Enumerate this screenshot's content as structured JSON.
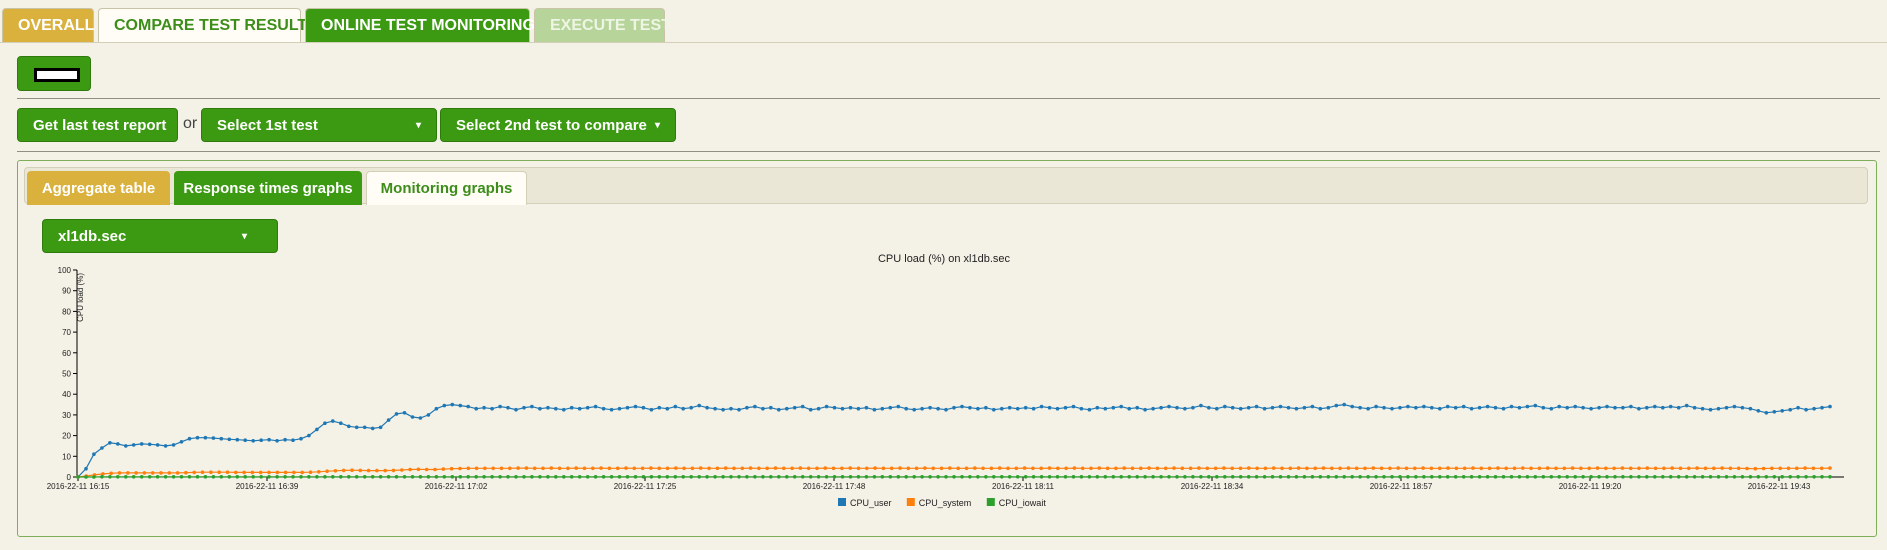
{
  "top_tabs": [
    {
      "label": "OVERALL"
    },
    {
      "label": "COMPARE TEST RESULTS"
    },
    {
      "label": "ONLINE TEST MONITORING"
    },
    {
      "label": "EXECUTE TEST"
    }
  ],
  "actions": {
    "last_report_label": "Get last test report",
    "or_label": "or",
    "select_first_label": "Select 1st test",
    "select_second_label": "Select 2nd test to compare"
  },
  "sub_tabs": [
    {
      "label": "Aggregate table"
    },
    {
      "label": "Response times graphs"
    },
    {
      "label": "Monitoring graphs"
    }
  ],
  "host_select": {
    "value": "xl1db.sec"
  },
  "chart_data": {
    "type": "line",
    "title": "CPU load (%) on xl1db.sec",
    "ylabel": "CPU load (%)",
    "xlabel": "",
    "ylim": [
      0,
      100
    ],
    "yticks": [
      0,
      10,
      20,
      30,
      40,
      50,
      60,
      70,
      80,
      90,
      100
    ],
    "xticks": [
      "2016-22-11 16:15",
      "2016-22-11 16:39",
      "2016-22-11 17:02",
      "2016-22-11 17:25",
      "2016-22-11 17:48",
      "2016-22-11 18:11",
      "2016-22-11 18:34",
      "2016-22-11 18:57",
      "2016-22-11 19:20",
      "2016-22-11 19:43"
    ],
    "legend_position": "bottom-center",
    "series": [
      {
        "name": "CPU_user",
        "color": "#1f77b4",
        "values": [
          0,
          4,
          11,
          14,
          16.5,
          16,
          15,
          15.5,
          16,
          15.8,
          15.5,
          15,
          15.5,
          17,
          18.5,
          19,
          19,
          18.8,
          18.5,
          18.2,
          18,
          17.8,
          17.5,
          17.8,
          18,
          17.5,
          18,
          17.8,
          18.5,
          20,
          23,
          26,
          27,
          26,
          24.5,
          24,
          24,
          23.5,
          24,
          27.5,
          30.5,
          31,
          29,
          28.5,
          30,
          33,
          34.5,
          35,
          34.5,
          34,
          33,
          33.5,
          33,
          34,
          33.5,
          32.5,
          33.5,
          34,
          33,
          33.5,
          33,
          32.5,
          33.5,
          33,
          33.5,
          34,
          33,
          32.5,
          33,
          33.5,
          34,
          33.5,
          32.5,
          33.5,
          33,
          34,
          33,
          33.5,
          34.5,
          33.5,
          33,
          32.5,
          33,
          32.5,
          33.5,
          34,
          33,
          33.5,
          32.5,
          33,
          33.5,
          34,
          32.5,
          33,
          34,
          33.5,
          33,
          33.5,
          33,
          33.5,
          32.5,
          33,
          33.5,
          34,
          33,
          32.5,
          33,
          33.5,
          33,
          32.5,
          33.5,
          34,
          33.5,
          33,
          33.5,
          32.5,
          33,
          33.5,
          33,
          33.5,
          33,
          34,
          33.5,
          33,
          33.5,
          34,
          33,
          32.5,
          33.5,
          33,
          33.5,
          34,
          33,
          33.5,
          32.5,
          33,
          33.5,
          34,
          33.5,
          33,
          33.5,
          34.5,
          33.5,
          33,
          34,
          33.5,
          33,
          33.5,
          34,
          33,
          33.5,
          34,
          33.5,
          33,
          33.5,
          34,
          33,
          33.5,
          34.5,
          35,
          34,
          33.5,
          33,
          34,
          33.5,
          33,
          33.5,
          34,
          33.5,
          34,
          33.5,
          33,
          34,
          33.5,
          34,
          33,
          33.5,
          34,
          33.5,
          33,
          34,
          33.5,
          34,
          34.5,
          33.5,
          33,
          34,
          33.5,
          34,
          33.5,
          33,
          33.5,
          34,
          33.5,
          33.5,
          34,
          33,
          33.5,
          34,
          33.5,
          34,
          33.5,
          34.5,
          33.5,
          33,
          32.5,
          33,
          33.5,
          34,
          33.5,
          33,
          32,
          31,
          31.5,
          32,
          32.5,
          33.5,
          32.5,
          33,
          33.5,
          34
        ]
      },
      {
        "name": "CPU_system",
        "color": "#ff7f0e",
        "values": [
          0,
          0.5,
          1,
          1.5,
          1.8,
          2,
          2,
          2,
          2,
          2,
          2,
          2,
          2,
          2.1,
          2.2,
          2.3,
          2.3,
          2.3,
          2.3,
          2.2,
          2.2,
          2.2,
          2.2,
          2.2,
          2.2,
          2.2,
          2.2,
          2.2,
          2.3,
          2.5,
          2.8,
          3,
          3.2,
          3.3,
          3.2,
          3.1,
          3.1,
          3.1,
          3.2,
          3.4,
          3.6,
          3.7,
          3.6,
          3.6,
          3.8,
          4,
          4.1,
          4.2,
          4.2,
          4.2,
          4.2,
          4.2,
          4.2,
          4.3,
          4.3,
          4.2,
          4.2,
          4.3,
          4.2,
          4.2,
          4.3,
          4.2,
          4.2,
          4.3,
          4.2,
          4.2,
          4.3,
          4.2,
          4.2,
          4.3,
          4.2,
          4.2,
          4.3,
          4.2,
          4.2,
          4.3,
          4.2,
          4.2,
          4.3,
          4.2,
          4.2,
          4.3,
          4.2,
          4.2,
          4.3,
          4.2,
          4.2,
          4.3,
          4.2,
          4.2,
          4.3,
          4.2,
          4.2,
          4.3,
          4.2,
          4.2,
          4.3,
          4.2,
          4.2,
          4.3,
          4.2,
          4.2,
          4.3,
          4.2,
          4.2,
          4.3,
          4.2,
          4.2,
          4.3,
          4.2,
          4.2,
          4.3,
          4.2,
          4.2,
          4.3,
          4.2,
          4.2,
          4.3,
          4.2,
          4.2,
          4.3,
          4.2,
          4.2,
          4.3,
          4.2,
          4.2,
          4.3,
          4.2,
          4.2,
          4.3,
          4.2,
          4.2,
          4.3,
          4.2,
          4.2,
          4.3,
          4.2,
          4.2,
          4.3,
          4.2,
          4.2,
          4.3,
          4.2,
          4.2,
          4.3,
          4.2,
          4.2,
          4.3,
          4.2,
          4.2,
          4.3,
          4.2,
          4.2,
          4.3,
          4.2,
          4.2,
          4.3,
          4.2,
          4.2,
          4.3,
          4.2,
          4.2,
          4.3,
          4.2,
          4.2,
          4.3,
          4.2,
          4.2,
          4.3,
          4.2,
          4.2,
          4.3,
          4.2,
          4.2,
          4.3,
          4.2,
          4.2,
          4.3,
          4.2,
          4.2,
          4.3,
          4.2,
          4.2,
          4.3,
          4.2,
          4.2,
          4.3,
          4.2,
          4.2,
          4.3,
          4.2,
          4.2,
          4.3,
          4.2,
          4.2,
          4.3,
          4.2,
          4.2,
          4.3,
          4.2,
          4.2,
          4.1,
          4,
          4.1,
          4.2,
          4.2,
          4.2,
          4.2,
          4.3,
          4.2,
          4.2,
          4.3
        ]
      },
      {
        "name": "CPU_iowait",
        "color": "#2ca02c",
        "values": [
          0,
          0,
          0,
          0.1,
          0.1,
          0.1,
          0.1,
          0.1,
          0.1,
          0.1,
          0.1,
          0.1,
          0.1,
          0.1,
          0.1,
          0.1,
          0.1,
          0.1,
          0.1,
          0.1,
          0.1,
          0.1,
          0.1,
          0.1,
          0.1,
          0.1,
          0.1,
          0.1,
          0.1,
          0.1,
          0.1,
          0.1,
          0.1,
          0.1,
          0.1,
          0.1,
          0.1,
          0.1,
          0.1,
          0.1,
          0.1,
          0.1,
          0.1,
          0.1,
          0.1,
          0.1,
          0.1,
          0.1,
          0.1,
          0.1,
          0.1,
          0.1,
          0.1,
          0.1,
          0.1,
          0.1,
          0.1,
          0.1,
          0.1,
          0.1,
          0.1,
          0.1,
          0.1,
          0.1,
          0.1,
          0.1,
          0.1,
          0.1,
          0.1,
          0.1,
          0.1,
          0.1,
          0.1,
          0.1,
          0.1,
          0.1,
          0.1,
          0.1,
          0.1,
          0.1,
          0.1,
          0.1,
          0.1,
          0.1,
          0.1,
          0.1,
          0.1,
          0.1,
          0.1,
          0.1,
          0.1,
          0.1,
          0.1,
          0.1,
          0.1,
          0.1,
          0.1,
          0.1,
          0.1,
          0.1,
          0.1,
          0.1,
          0.1,
          0.1,
          0.1,
          0.1,
          0.1,
          0.1,
          0.1,
          0.1,
          0.1,
          0.1,
          0.1,
          0.1,
          0.1,
          0.1,
          0.1,
          0.1,
          0.1,
          0.1,
          0.1,
          0.1,
          0.1,
          0.1,
          0.1,
          0.1,
          0.1,
          0.1,
          0.1,
          0.1,
          0.1,
          0.1,
          0.1,
          0.1,
          0.1,
          0.1,
          0.1,
          0.1,
          0.1,
          0.1,
          0.1,
          0.1,
          0.1,
          0.1,
          0.1,
          0.1,
          0.1,
          0.1,
          0.1,
          0.1,
          0.1,
          0.1,
          0.1,
          0.1,
          0.1,
          0.1,
          0.1,
          0.1,
          0.1,
          0.1,
          0.1,
          0.1,
          0.1,
          0.1,
          0.1,
          0.1,
          0.1,
          0.1,
          0.1,
          0.1,
          0.1,
          0.1,
          0.1,
          0.1,
          0.1,
          0.1,
          0.1,
          0.1,
          0.1,
          0.1,
          0.1,
          0.1,
          0.1,
          0.1,
          0.1,
          0.1,
          0.1,
          0.1,
          0.1,
          0.1,
          0.1,
          0.1,
          0.1,
          0.1,
          0.1,
          0.1,
          0.1,
          0.1,
          0.1,
          0.1,
          0.1,
          0.1,
          0.1,
          0.1,
          0.1,
          0.1,
          0.1,
          0.1,
          0.1,
          0.1,
          0.1,
          0.1,
          0.1,
          0.1,
          0.1,
          0.1,
          0.1,
          0.1,
          0.1,
          0.1,
          0.1
        ]
      }
    ]
  }
}
